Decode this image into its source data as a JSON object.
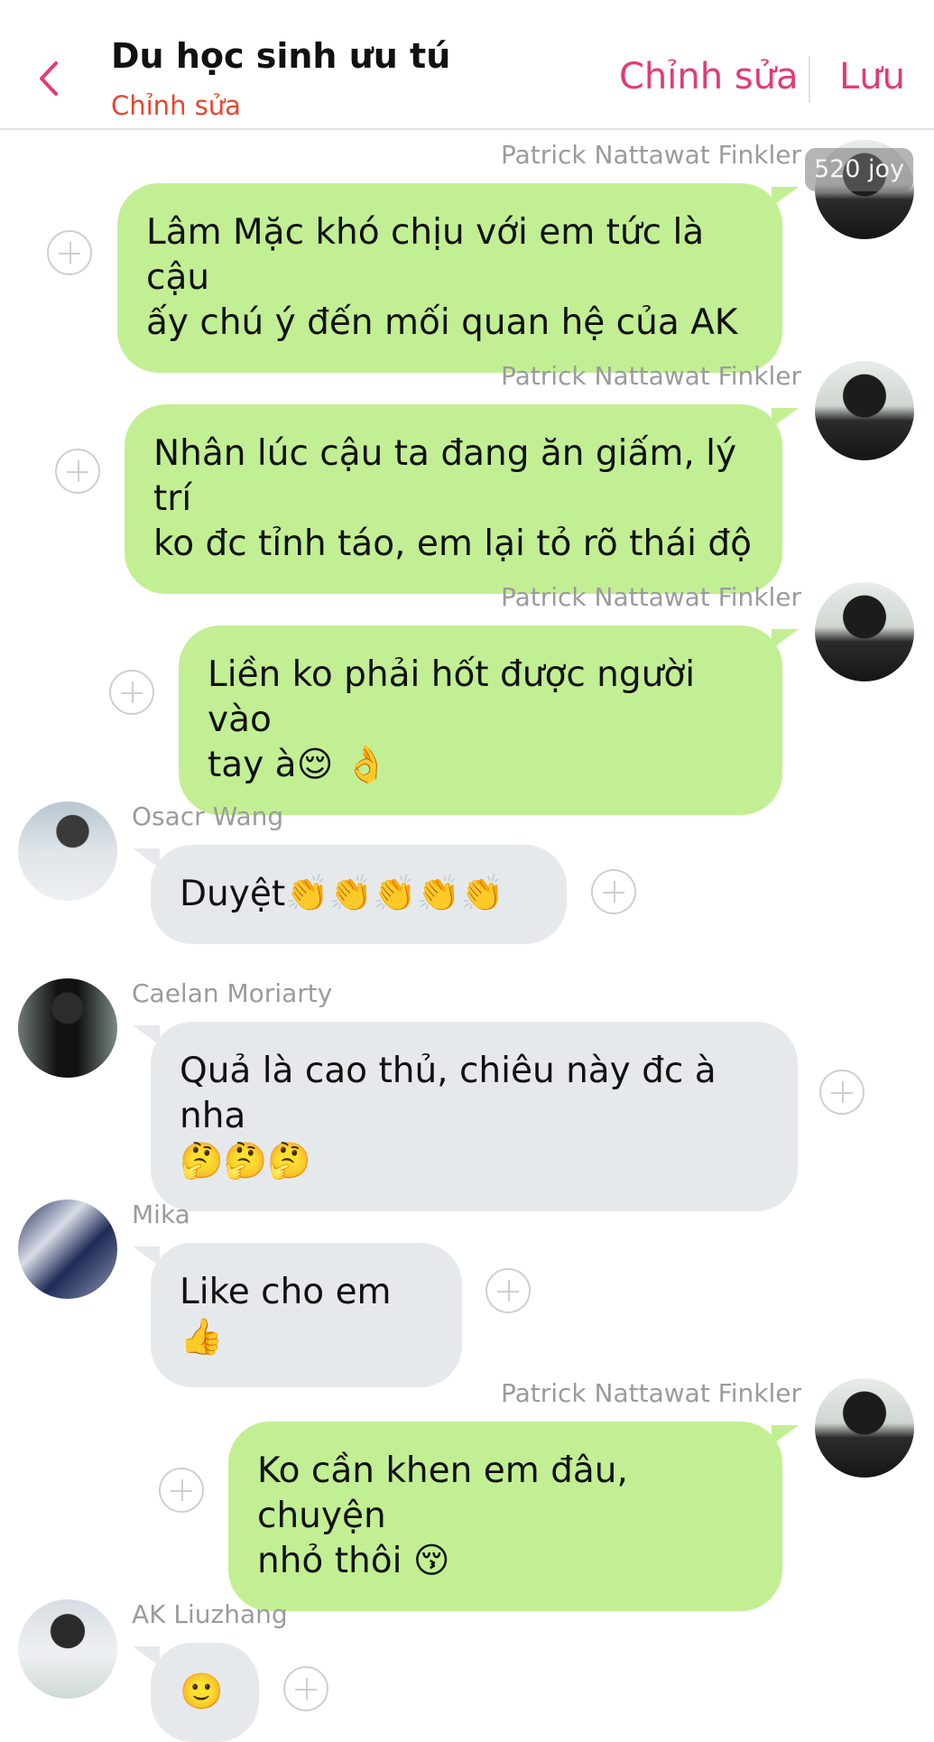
{
  "header": {
    "title": "Du học sinh ưu tú",
    "subtitle": "Chỉnh sửa",
    "edit_label": "Chỉnh sửa",
    "save_label": "Lưu",
    "accent_color": "#e23a78",
    "subtitle_color": "#e8452e"
  },
  "watermark": "520 joy",
  "messages": [
    {
      "side": "out",
      "sender": "Patrick Nattawat Finkler",
      "lines": [
        "Lâm Mặc khó chịu với em tức là cậu",
        "ấy chú ý đến mối quan hệ của AK"
      ]
    },
    {
      "side": "out",
      "sender": "Patrick Nattawat Finkler",
      "lines": [
        "Nhân lúc cậu ta đang ăn giấm, lý trí",
        "ko đc tỉnh táo, em lại tỏ rõ thái độ"
      ]
    },
    {
      "side": "out",
      "sender": "Patrick Nattawat Finkler",
      "lines": [
        "Liền ko phải hốt được người vào",
        "tay à😌 👌"
      ]
    },
    {
      "side": "in",
      "sender": "Osacr Wang",
      "lines": [
        "Duyệt👏👏👏👏👏"
      ]
    },
    {
      "side": "in",
      "sender": "Caelan Moriarty",
      "lines": [
        "Quả là cao thủ, chiêu này đc à nha",
        "🤔🤔🤔"
      ]
    },
    {
      "side": "in",
      "sender": "Mika",
      "lines": [
        "Like cho em👍"
      ]
    },
    {
      "side": "out",
      "sender": "Patrick Nattawat Finkler",
      "lines": [
        "Ko cần khen em đâu, chuyện",
        "nhỏ thôi 😚"
      ]
    },
    {
      "side": "in",
      "sender": "AK Liuzhang",
      "lines": [
        "🙂"
      ]
    }
  ],
  "icons": {
    "back": "chevron-left-icon",
    "react": "add-reaction-icon",
    "avatar": "avatar"
  },
  "colors": {
    "outgoing_bubble": "#c2ef93",
    "incoming_bubble": "#e6e9ec"
  }
}
